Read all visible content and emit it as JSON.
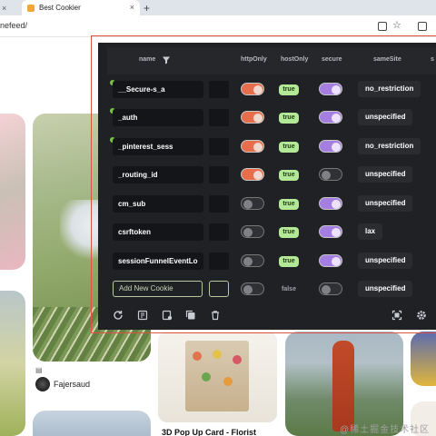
{
  "browser": {
    "tabs": [
      {
        "label": ""
      },
      {
        "label": "Best Cookier",
        "close": "×"
      }
    ],
    "new_tab": "+",
    "url": "nefeed/"
  },
  "feed": {
    "card_meta": "▤",
    "username": "Fajersaud",
    "card_title": "3D Pop Up Card - Florist",
    "watermark": "@稀土掘金技术社区"
  },
  "cookie_editor": {
    "columns": {
      "name": "name",
      "httpOnly": "httpOnly",
      "hostOnly": "hostOnly",
      "secure": "secure",
      "sameSite": "sameSite",
      "extra": "s"
    },
    "rows": [
      {
        "name": "__Secure-s_a",
        "flag_dot": true,
        "httpOnly": true,
        "hostOnly": "true",
        "secure": true,
        "sameSite": "no_restriction"
      },
      {
        "name": "_auth",
        "flag_dot": true,
        "httpOnly": true,
        "hostOnly": "true",
        "secure": true,
        "sameSite": "unspecified"
      },
      {
        "name": "_pinterest_sess",
        "flag_dot": true,
        "httpOnly": true,
        "hostOnly": "true",
        "secure": true,
        "sameSite": "no_restriction"
      },
      {
        "name": "_routing_id",
        "flag_dot": false,
        "httpOnly": true,
        "hostOnly": "true",
        "secure": false,
        "sameSite": "unspecified"
      },
      {
        "name": "cm_sub",
        "flag_dot": false,
        "httpOnly": false,
        "hostOnly": "true",
        "secure": true,
        "sameSite": "unspecified"
      },
      {
        "name": "csrftoken",
        "flag_dot": false,
        "httpOnly": false,
        "hostOnly": "true",
        "secure": true,
        "sameSite": "lax"
      },
      {
        "name": "sessionFunnelEventLo",
        "flag_dot": false,
        "httpOnly": false,
        "hostOnly": "true",
        "secure": true,
        "sameSite": "unspecified"
      }
    ],
    "new_row": {
      "placeholder": "Add New Cookie",
      "hostOnly": "false",
      "sameSite": "unspecified"
    },
    "toolbar": [
      "refresh-icon",
      "import-icon",
      "export-icon",
      "copy-icon",
      "delete-icon",
      "fullscreen-icon",
      "settings-icon"
    ],
    "colors": {
      "accent_orange": "#e86d4c",
      "accent_purple": "#a47ee0",
      "true_badge": "#b3e896",
      "frame": "#e0523f"
    }
  }
}
